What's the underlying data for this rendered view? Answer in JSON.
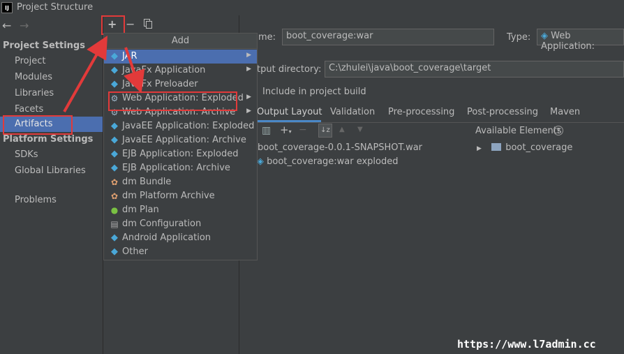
{
  "window": {
    "title": "Project Structure",
    "app_icon": "IJ"
  },
  "nav": {
    "back_icon": "←",
    "forward_icon": "→"
  },
  "left_panel": {
    "project_settings_header": "Project Settings",
    "project_items": [
      "Project",
      "Modules",
      "Libraries",
      "Facets",
      "Artifacts"
    ],
    "platform_settings_header": "Platform Settings",
    "platform_items": [
      "SDKs",
      "Global Libraries"
    ],
    "problems": "Problems",
    "selected": "Artifacts"
  },
  "toolbar": {
    "add": "+",
    "remove": "−",
    "copy_icon": "copy-icon"
  },
  "menu": {
    "title": "Add",
    "items": [
      {
        "label": "JAR",
        "icon": "diamond-icon",
        "submenu": true,
        "selected": true
      },
      {
        "label": "JavaFx Application",
        "icon": "diamond-icon",
        "submenu": true
      },
      {
        "label": "JavaFx Preloader",
        "icon": "diamond-icon",
        "submenu": false
      },
      {
        "label": "Web Application: Exploded",
        "icon": "web-gear-icon",
        "submenu": true
      },
      {
        "label": "Web Application: Archive",
        "icon": "web-gear-icon",
        "submenu": true
      },
      {
        "label": "JavaEE Application: Exploded",
        "icon": "diamond-icon",
        "submenu": false
      },
      {
        "label": "JavaEE Application: Archive",
        "icon": "diamond-icon",
        "submenu": false
      },
      {
        "label": "EJB Application: Exploded",
        "icon": "diamond-icon",
        "submenu": false
      },
      {
        "label": "EJB Application: Archive",
        "icon": "diamond-icon",
        "submenu": false
      },
      {
        "label": "dm Bundle",
        "icon": "dm-bundle-icon",
        "submenu": false
      },
      {
        "label": "dm Platform Archive",
        "icon": "dm-archive-icon",
        "submenu": false
      },
      {
        "label": "dm Plan",
        "icon": "dm-plan-icon",
        "submenu": false
      },
      {
        "label": "dm Configuration",
        "icon": "config-icon",
        "submenu": false
      },
      {
        "label": "Android Application",
        "icon": "diamond-icon",
        "submenu": false
      },
      {
        "label": "Other",
        "icon": "diamond-icon",
        "submenu": false
      }
    ]
  },
  "right_panel": {
    "name_label": "me:",
    "name_value": "boot_coverage:war",
    "type_label": "Type:",
    "type_value": "Web Application:",
    "output_label": "tput directory:",
    "output_value": "C:\\zhulei\\java\\boot_coverage\\target",
    "include_label": "Include in project build",
    "tabs": [
      "Output Layout",
      "Validation",
      "Pre-processing",
      "Post-processing",
      "Maven"
    ],
    "available_elements": "Available Elements",
    "help_icon": "?",
    "tree_left": [
      "boot_coverage-0.0.1-SNAPSHOT.war",
      "boot_coverage:war exploded"
    ],
    "tree_right": [
      "boot_coverage"
    ]
  },
  "watermark": "https://www.l7admin.cc",
  "colors": {
    "selection": "#4b6eaf",
    "annotation": "#e23a3a",
    "background": "#3c3f41"
  }
}
